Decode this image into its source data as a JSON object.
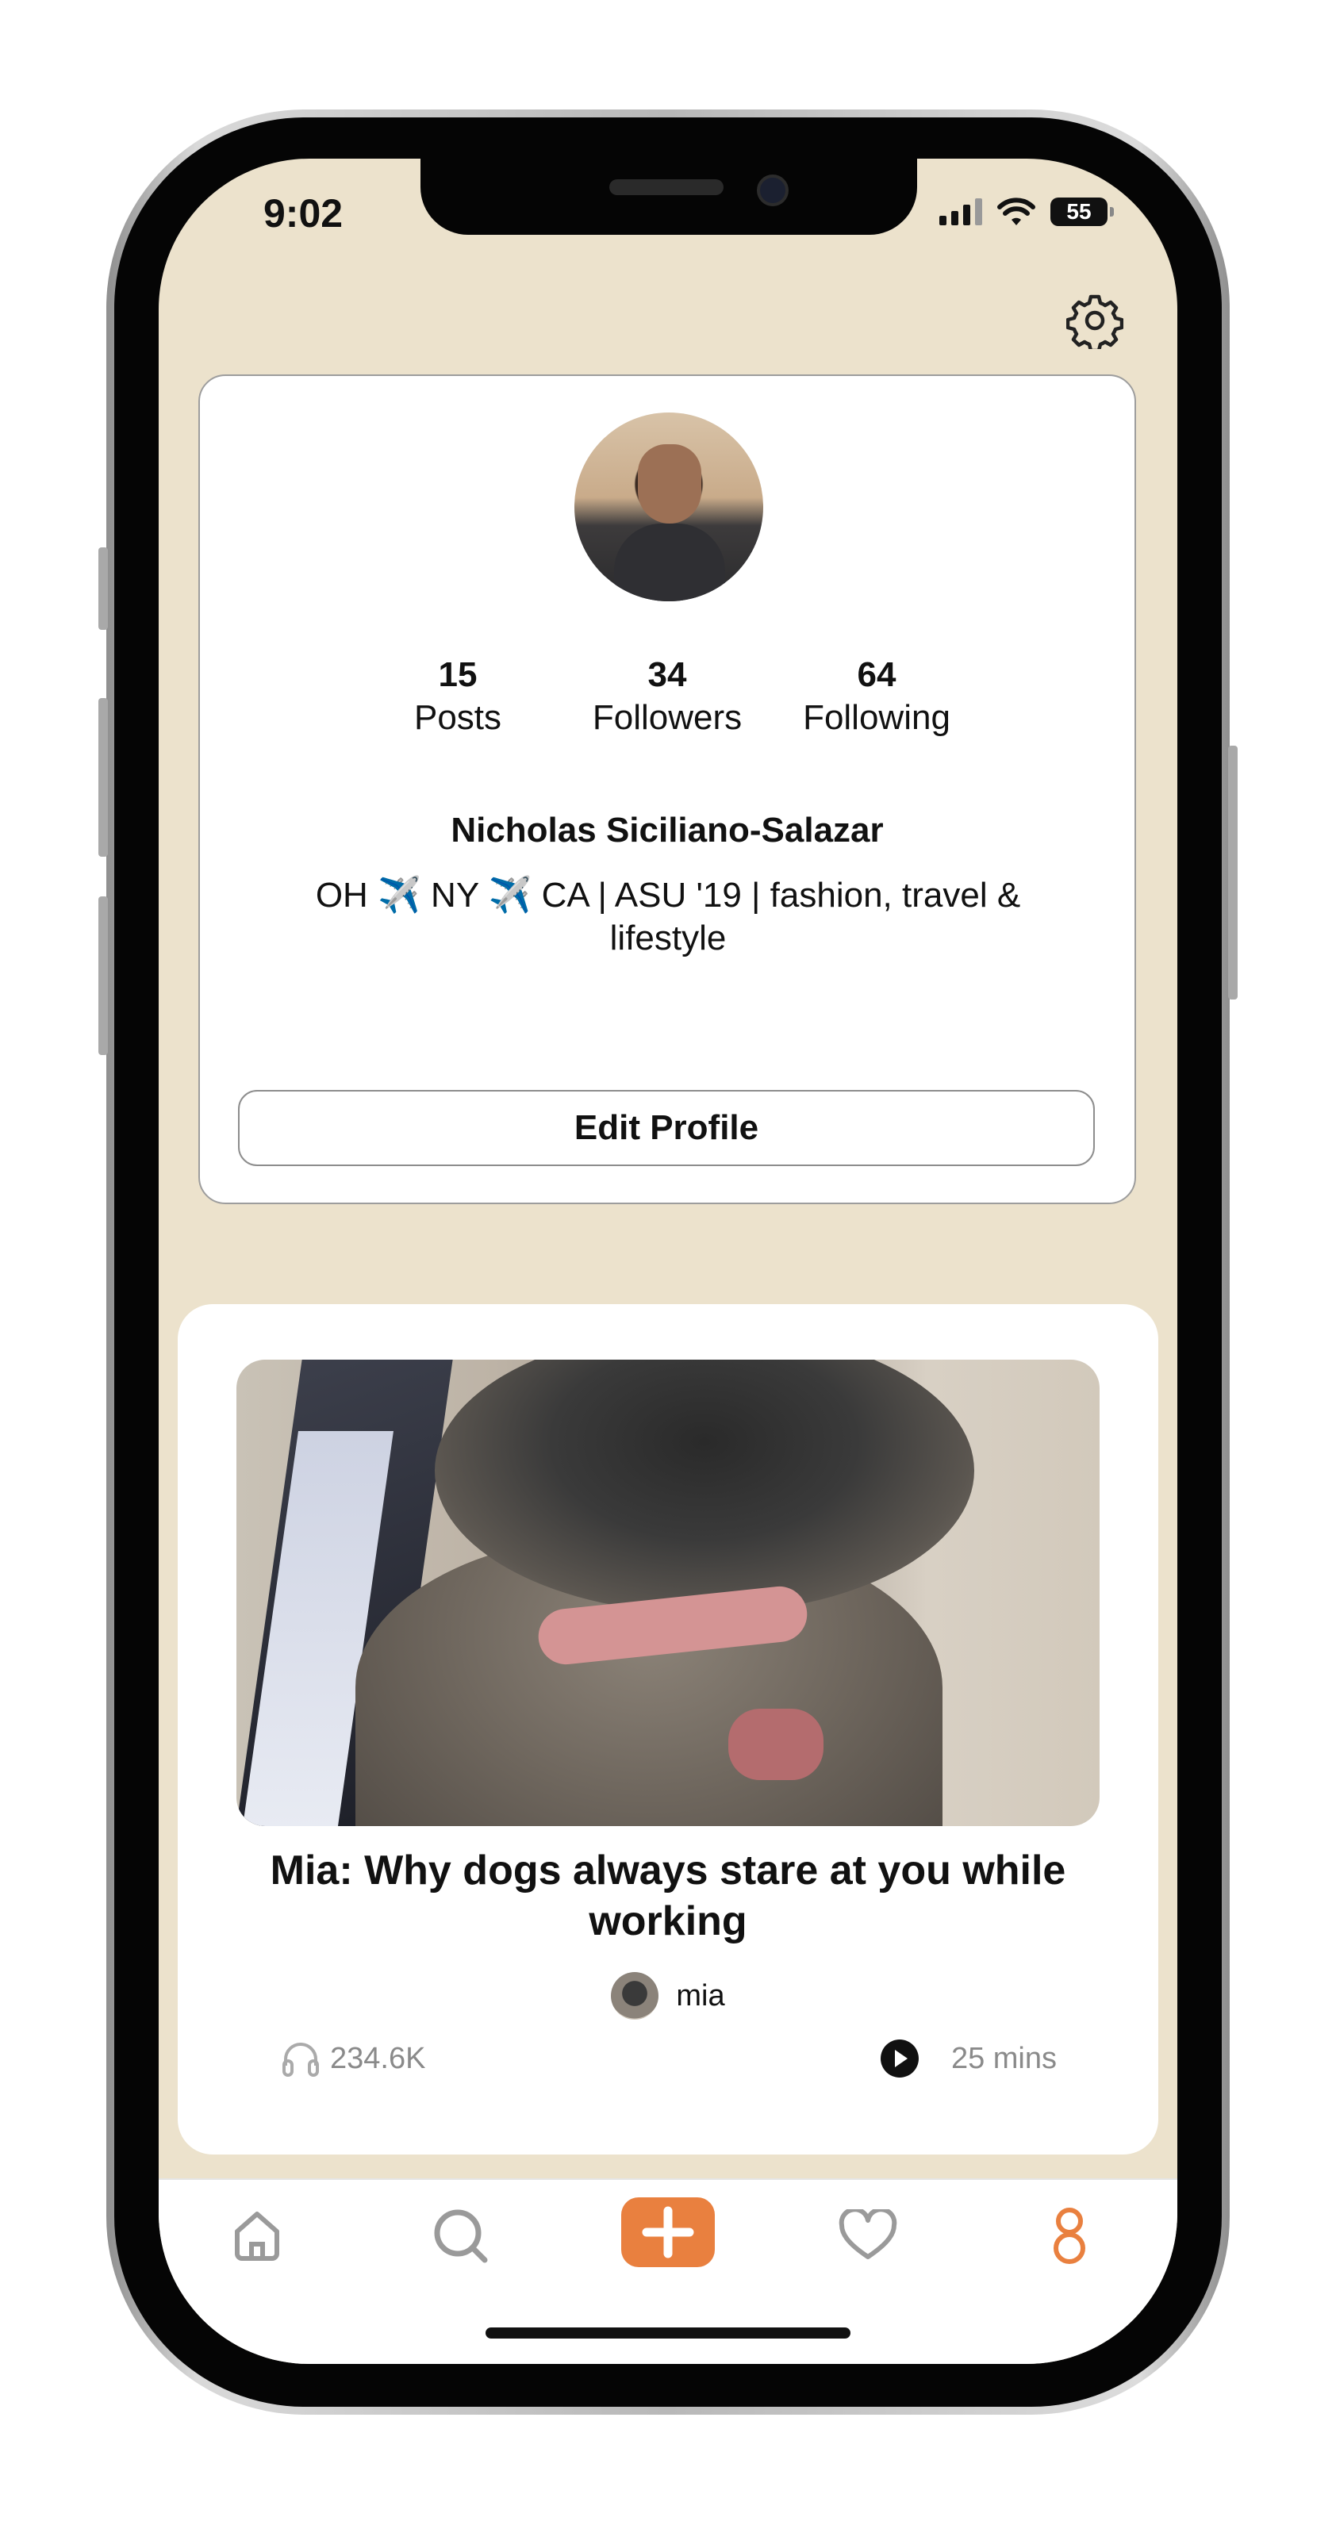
{
  "status_bar": {
    "time": "9:02",
    "battery": "55"
  },
  "profile": {
    "stats": [
      {
        "value": "15",
        "label": "Posts"
      },
      {
        "value": "34",
        "label": "Followers"
      },
      {
        "value": "64",
        "label": "Following"
      }
    ],
    "name": "Nicholas Siciliano-Salazar",
    "bio": "OH ✈️ NY ✈️ CA   |   ASU '19   |   fashion, travel & lifestyle",
    "edit_button": "Edit Profile"
  },
  "post": {
    "title": "Mia: Why dogs always stare at you while working",
    "author": "mia",
    "listens": "234.6K",
    "duration": "25 mins"
  },
  "tab_bar": {
    "items": [
      "home-icon",
      "search-icon",
      "add-icon",
      "heart-icon",
      "profile-icon"
    ],
    "active": "profile-icon",
    "accent": "#e9803f"
  },
  "colors": {
    "background": "#ece2cc",
    "card": "#ffffff",
    "accent": "#e9803f"
  }
}
